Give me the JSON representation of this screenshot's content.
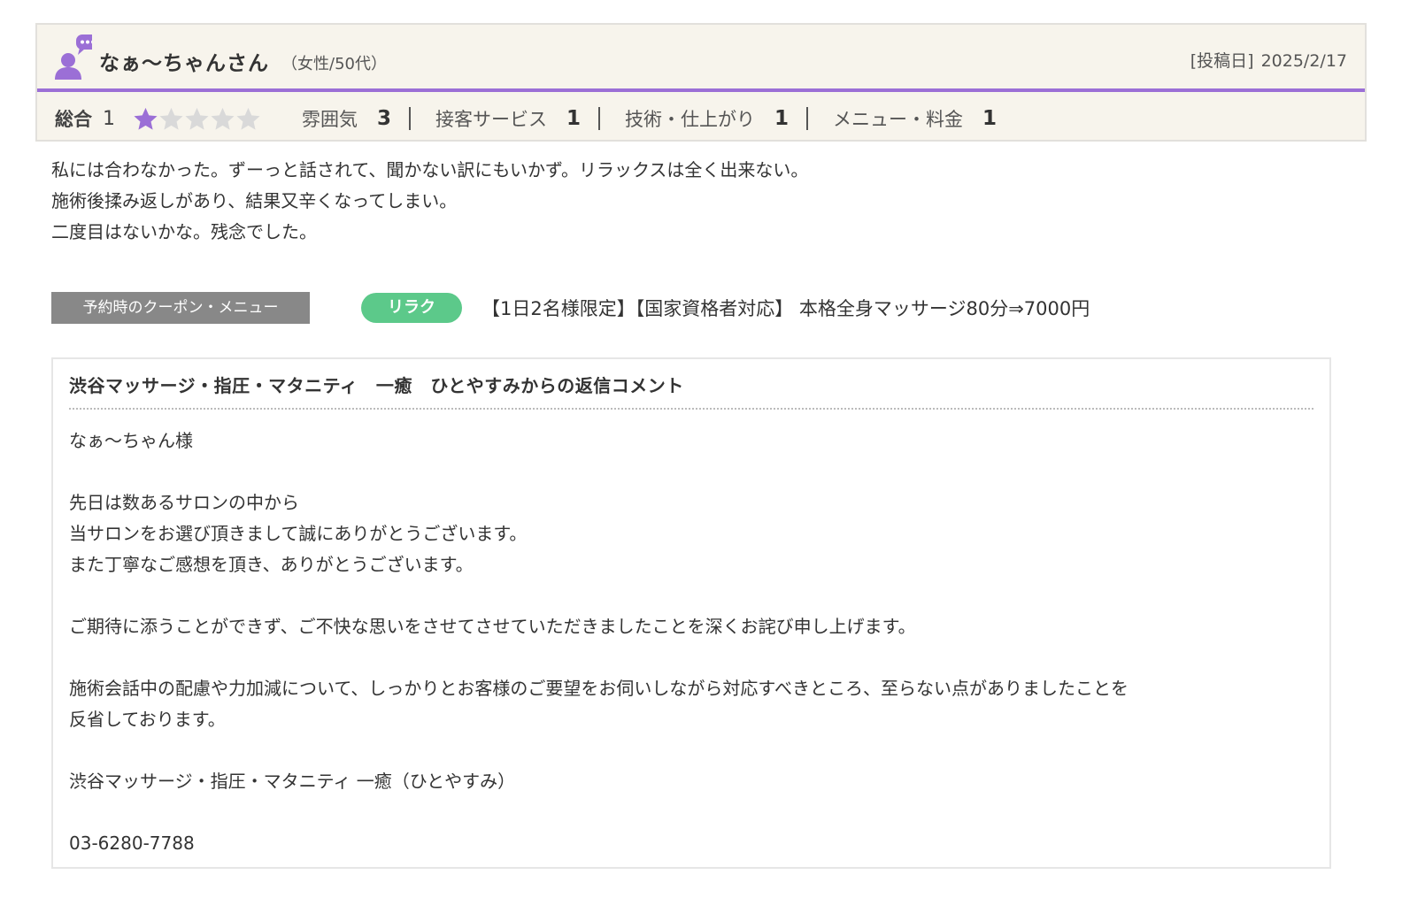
{
  "reviewer": {
    "name": "なぁ〜ちゃんさん",
    "meta": "（女性/50代）",
    "post_date_label": "[投稿日]",
    "post_date": "2025/2/17"
  },
  "rating": {
    "total_label": "総合",
    "total_value": "1",
    "stars_filled": 1,
    "stars_total": 5,
    "metrics": [
      {
        "label": "雰囲気",
        "value": "3"
      },
      {
        "label": "接客サービス",
        "value": "1"
      },
      {
        "label": "技術・仕上がり",
        "value": "1"
      },
      {
        "label": "メニュー・料金",
        "value": "1"
      }
    ]
  },
  "review_text": "私には合わなかった。ずーっと話されて、聞かない訳にもいかず。リラックスは全く出来ない。\n施術後揉み返しがあり、結果又辛くなってしまい。\n二度目はないかな。残念でした。",
  "coupon": {
    "label": "予約時のクーポン・メニュー",
    "tag": "リラク",
    "text": "【1日2名様限定】【国家資格者対応】 本格全身マッサージ80分⇒7000円"
  },
  "reply": {
    "title": "渋谷マッサージ・指圧・マタニティ　一癒　ひとやすみからの返信コメント",
    "body": "なぁ〜ちゃん様\n\n先日は数あるサロンの中から\n当サロンをお選び頂きまして誠にありがとうございます。\nまた丁寧なご感想を頂き、ありがとうございます。\n\nご期待に添うことができず、ご不快な思いをさせてさせていただきましたことを深くお詫び申し上げます。\n\n施術会話中の配慮や力加減について、しっかりとお客様のご要望をお伺いしながら対応すべきところ、至らない点がありましたことを\n反省しております。\n\n渋谷マッサージ・指圧・マタニティ 一癒（ひとやすみ）\n\n03-6280-7788"
  },
  "colors": {
    "accent": "#9b6fd6",
    "header_bg": "#f7f4ec",
    "star_filled": "#9b6fd6",
    "star_empty": "#d9d9d9",
    "coupon_label_bg": "#888888",
    "coupon_tag_bg": "#5cc98a"
  }
}
